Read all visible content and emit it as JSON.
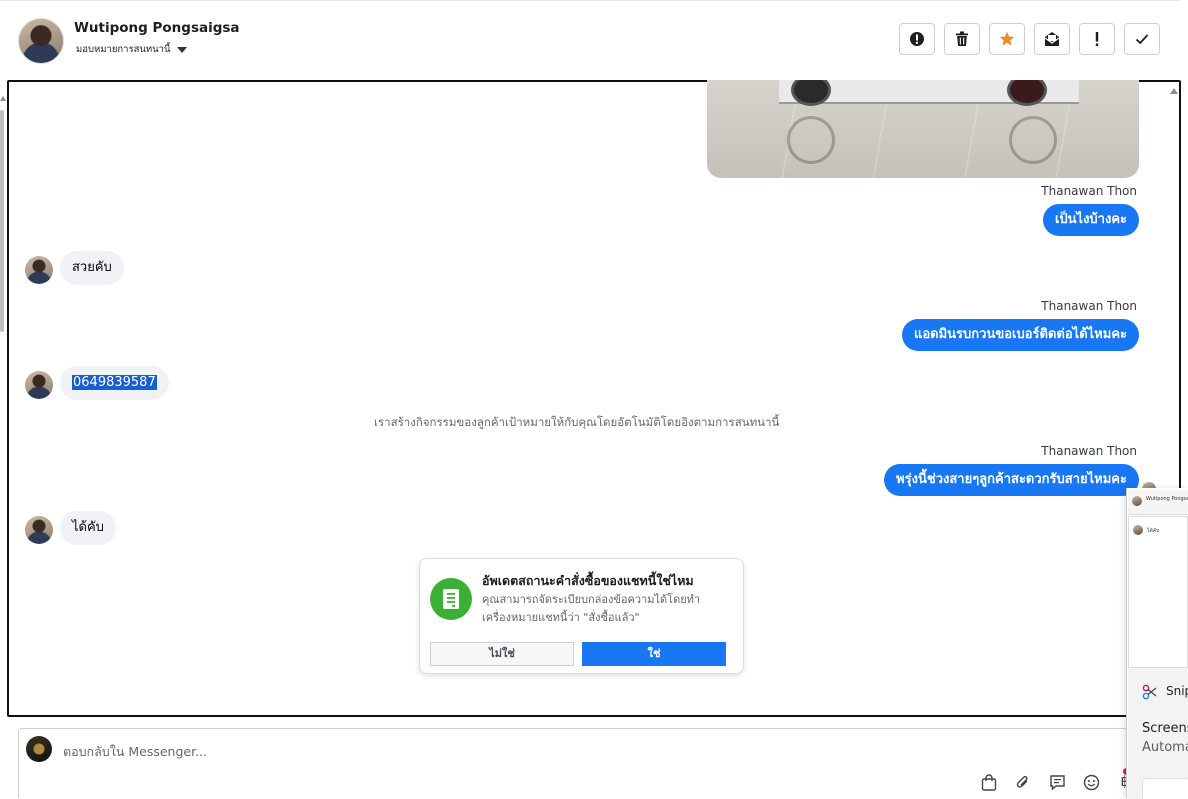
{
  "header": {
    "contact_name": "Wutipong Pongsaigsa",
    "assign_label": "มอบหมายการสนทนานี้",
    "actions": [
      {
        "name": "report-spam-button",
        "icon": "exclamation-circle-icon"
      },
      {
        "name": "delete-button",
        "icon": "trash-icon"
      },
      {
        "name": "star-button",
        "icon": "star-icon"
      },
      {
        "name": "mark-unread-button",
        "icon": "mail-open-icon"
      },
      {
        "name": "mark-important-button",
        "icon": "exclamation-icon"
      },
      {
        "name": "mark-done-button",
        "icon": "check-icon"
      }
    ]
  },
  "messages": {
    "sender_1": "Thanawan Thon",
    "out_1": "เป็นไงบ้างคะ",
    "in_1": "สวยคับ",
    "sender_2": "Thanawan Thon",
    "out_2": "แอดมินรบกวนขอเบอร์ติดต่อได้ไหมคะ",
    "in_2": "0649839587",
    "system_note": "เราสร้างกิจกรรมของลูกค้าเป้าหมายให้กับคุณโดยอัตโนมัติโดยอิงตามการสนทนานี้",
    "sender_3": "Thanawan Thon",
    "out_3": "พรุ่งนี้ช่วงสายๆลูกค้าสะดวกรับสายไหมคะ",
    "in_3": "ได้คับ"
  },
  "prompt": {
    "title": "อัพเดตสถานะคำสั่งซื้อของแชทนี้ใช่ไหม",
    "body": "คุณสามารถจัดระเบียบกล่องข้อความได้โดยทำเครื่องหมายแชทนี้ว่า \"สั่งซื้อแล้ว\"",
    "no_label": "ไม่ใช่",
    "yes_label": "ใช่"
  },
  "reply": {
    "placeholder": "ตอบกลับใน Messenger...",
    "tools": [
      "shopping-bag-icon",
      "paperclip-icon",
      "saved-reply-icon",
      "emoji-icon",
      "baht-icon"
    ]
  },
  "overlay": {
    "snip_label": "Snip",
    "snip_title": "Screens",
    "snip_sub": "Automa"
  },
  "colors": {
    "accent": "#1877f2",
    "bubble_in": "#f0f2f5",
    "prompt_icon": "#3cb034",
    "star": "#f08a24"
  }
}
